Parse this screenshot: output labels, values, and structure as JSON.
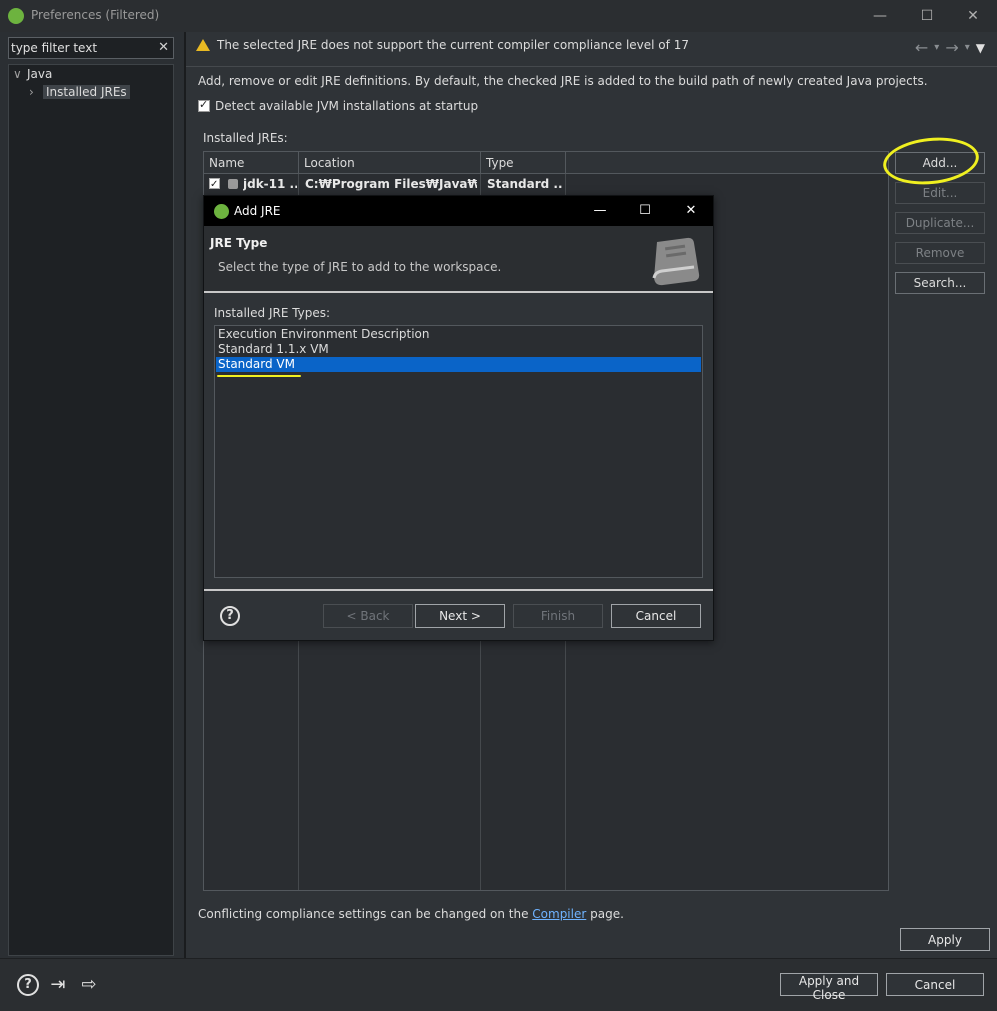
{
  "window": {
    "title": "Preferences (Filtered)",
    "controls": [
      "minimize-icon",
      "maximize-icon",
      "close-icon"
    ]
  },
  "filter": {
    "value": "type filter text",
    "clear_icon": "✕"
  },
  "tree": {
    "items": [
      {
        "label": "Java",
        "expanded": true,
        "level": 0
      },
      {
        "label": "Installed JREs",
        "expanded": false,
        "level": 1,
        "selected": true
      }
    ]
  },
  "page": {
    "warning": "The selected JRE does not support the current compiler compliance level of 17",
    "description": "Add, remove or edit JRE definitions. By default, the checked JRE is added to the build path of newly created Java projects.",
    "detect_checkbox": {
      "label": "Detect available JVM installations at startup",
      "checked": true
    },
    "installed_label": "Installed JREs:",
    "table": {
      "headers": [
        "Name",
        "Location",
        "Type"
      ],
      "rows": [
        {
          "name": "jdk-11 ...",
          "location": "C:₩Program Files₩Java₩jd...",
          "type": "Standard ...",
          "checked": true
        }
      ]
    },
    "buttons": {
      "add": "Add...",
      "edit": "Edit...",
      "duplicate": "Duplicate...",
      "remove": "Remove",
      "search": "Search..."
    },
    "footer_prefix": "Conflicting compliance settings can be changed on the ",
    "footer_link": "Compiler",
    "footer_suffix": " page.",
    "apply": "Apply"
  },
  "bottom": {
    "apply_close": "Apply and Close",
    "cancel": "Cancel",
    "icons": [
      "help-icon",
      "import-icon",
      "export-icon"
    ]
  },
  "dialog": {
    "title": "Add JRE",
    "heading": "JRE Type",
    "subtitle": "Select the type of JRE to add to the workspace.",
    "list_label": "Installed JRE Types:",
    "types": [
      "Execution Environment Description",
      "Standard 1.1.x VM",
      "Standard VM"
    ],
    "selected_type": "Standard VM",
    "buttons": {
      "back": "< Back",
      "next": "Next >",
      "finish": "Finish",
      "cancel": "Cancel"
    }
  },
  "colors": {
    "selection": "#0a64c8",
    "annotation": "#f0f020",
    "link": "#6fb3ff",
    "warning": "#e8b923",
    "spring_green": "#6db33f"
  }
}
